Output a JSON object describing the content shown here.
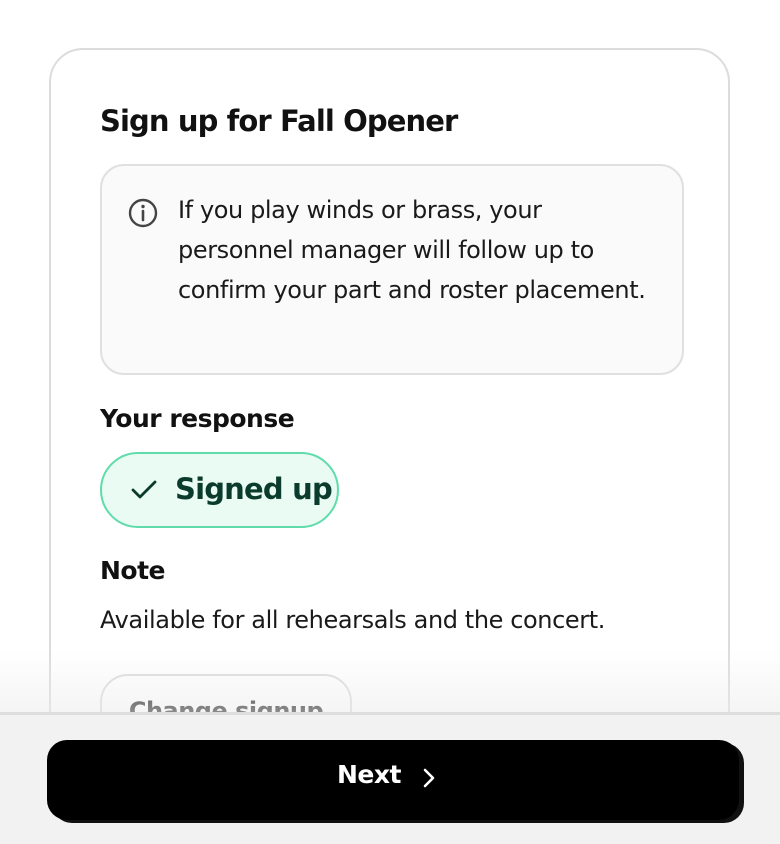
{
  "card": {
    "title": "Sign up for Fall Opener",
    "info": {
      "icon": "info-circle-icon",
      "text": "If you play winds or brass, your personnel manager will follow up to confirm your part and roster placement."
    },
    "response": {
      "label": "Your response",
      "status_icon": "checkmark-icon",
      "status": "Signed up",
      "status_color": "#5fdcaa",
      "status_bg": "#e9fbf3"
    },
    "note": {
      "label": "Note",
      "text": "Available for all rehearsals and the concert."
    },
    "change_button_label": "Change signup"
  },
  "footer": {
    "next_label": "Next",
    "next_icon": "chevron-right-icon",
    "next_bg": "#000000"
  }
}
